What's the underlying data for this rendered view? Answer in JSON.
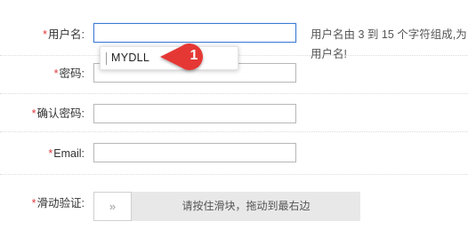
{
  "form": {
    "username": {
      "required_mark": "*",
      "label": "用户名:",
      "value": "",
      "hint": "用户名由 3 到 15 个字符组成,为用户名!"
    },
    "password": {
      "required_mark": "*",
      "label": "密码:",
      "value": ""
    },
    "confirm_password": {
      "required_mark": "*",
      "label": "确认密码:",
      "value": ""
    },
    "email": {
      "required_mark": "*",
      "label": "Email:",
      "value": ""
    },
    "slide_verify": {
      "required_mark": "*",
      "label": "滑动验证:",
      "handle_icon": "double-chevron-right-icon",
      "handle_glyph": "»",
      "instruction": "请按住滑块，拖动到最右边"
    }
  },
  "autocomplete": {
    "suggestion": "MYDLL"
  },
  "callout": {
    "number": "1",
    "color": "#e53935"
  },
  "colors": {
    "required": "#e4393c",
    "focus_border": "#3a7bd5"
  }
}
